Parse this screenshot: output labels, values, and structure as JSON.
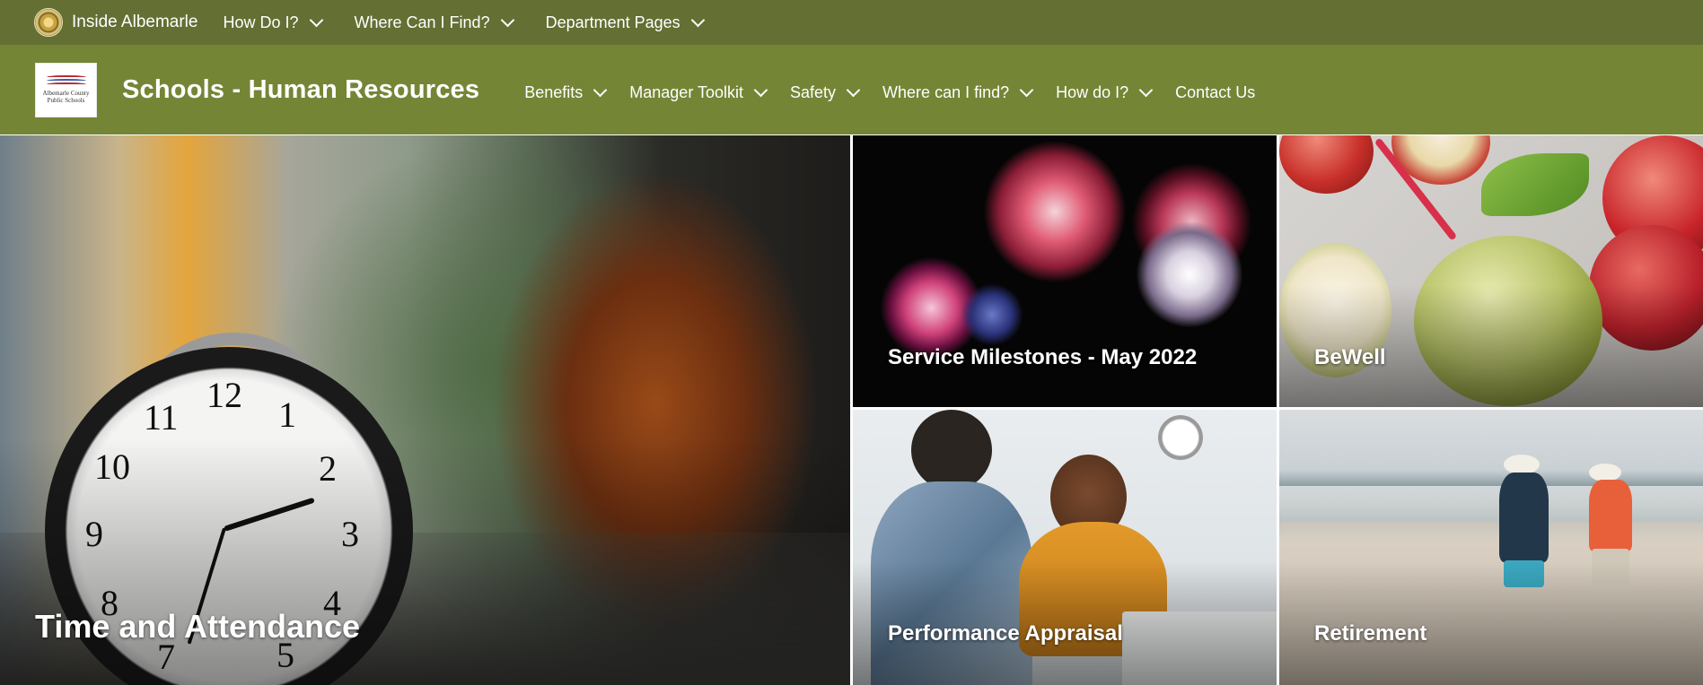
{
  "suitebar": {
    "title": "Inside Albemarle",
    "nav": [
      {
        "label": "How Do I?"
      },
      {
        "label": "Where Can I Find?"
      },
      {
        "label": "Department Pages"
      }
    ]
  },
  "site": {
    "logo_text": [
      "Albemarle County",
      "Public Schools"
    ],
    "title": "Schools - Human Resources",
    "nav": [
      {
        "label": "Benefits"
      },
      {
        "label": "Manager Toolkit"
      },
      {
        "label": "Safety"
      },
      {
        "label": "Where can I find?"
      },
      {
        "label": "How do I?"
      },
      {
        "label": "Contact Us"
      }
    ]
  },
  "hero": {
    "tiles": [
      {
        "label": "Time and Attendance"
      },
      {
        "label": "Service Milestones - May 2022"
      },
      {
        "label": "BeWell"
      },
      {
        "label": "Performance Appraisal"
      },
      {
        "label": "Retirement"
      }
    ]
  },
  "colors": {
    "suitebar_bg": "#636f33",
    "header_bg": "#758536",
    "text": "#ffffff"
  }
}
